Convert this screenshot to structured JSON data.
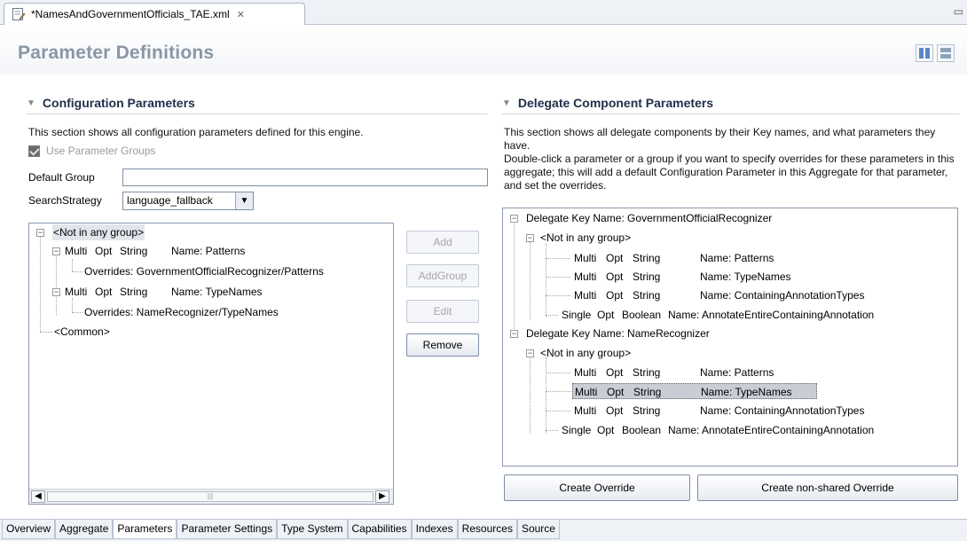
{
  "editor": {
    "filename": "*NamesAndGovernmentOfficials_TAE.xml"
  },
  "page": {
    "title": "Parameter Definitions"
  },
  "config": {
    "title": "Configuration Parameters",
    "description": "This section shows all configuration parameters defined for this engine.",
    "use_groups_label": "Use Parameter Groups",
    "use_groups_checked": true,
    "default_group_label": "Default Group",
    "default_group_value": "",
    "search_strategy_label": "SearchStrategy",
    "search_strategy_value": "language_fallback",
    "tree": {
      "group_not_in_any": "<Not in any group>",
      "params": [
        {
          "mult": "Multi",
          "opt": "Opt",
          "type": "String",
          "name": "Name: Patterns",
          "override": "Overrides: GovernmentOfficialRecognizer/Patterns"
        },
        {
          "mult": "Multi",
          "opt": "Opt",
          "type": "String",
          "name": "Name: TypeNames",
          "override": "Overrides: NameRecognizer/TypeNames"
        }
      ],
      "group_common": "<Common>"
    },
    "buttons": {
      "add": "Add",
      "add_group": "AddGroup",
      "edit": "Edit",
      "remove": "Remove"
    }
  },
  "delegate": {
    "title": "Delegate Component Parameters",
    "description_1": "This section shows all delegate components by their Key names, and what parameters they have.",
    "description_2": "Double-click a parameter or a group if you want to specify overrides for these parameters in this aggregate; this will add a default Configuration Parameter in this Aggregate for that parameter, and set the overrides.",
    "delegates": [
      {
        "key": "Delegate Key Name: GovernmentOfficialRecognizer",
        "group": "<Not in any group>",
        "params": [
          {
            "mult": "Multi",
            "opt": "Opt",
            "type": "String",
            "name": "Name: Patterns"
          },
          {
            "mult": "Multi",
            "opt": "Opt",
            "type": "String",
            "name": "Name: TypeNames"
          },
          {
            "mult": "Multi",
            "opt": "Opt",
            "type": "String",
            "name": "Name: ContainingAnnotationTypes"
          },
          {
            "mult": "Single",
            "opt": "Opt",
            "type": "Boolean",
            "name": "Name: AnnotateEntireContainingAnnotation"
          }
        ]
      },
      {
        "key": "Delegate Key Name: NameRecognizer",
        "group": "<Not in any group>",
        "params": [
          {
            "mult": "Multi",
            "opt": "Opt",
            "type": "String",
            "name": "Name: Patterns"
          },
          {
            "mult": "Multi",
            "opt": "Opt",
            "type": "String",
            "name": "Name: TypeNames"
          },
          {
            "mult": "Multi",
            "opt": "Opt",
            "type": "String",
            "name": "Name: ContainingAnnotationTypes"
          },
          {
            "mult": "Single",
            "opt": "Opt",
            "type": "Boolean",
            "name": "Name: AnnotateEntireContainingAnnotation"
          }
        ]
      }
    ],
    "buttons": {
      "create_override": "Create Override",
      "create_non_shared": "Create non-shared Override"
    }
  },
  "bottom_tabs": [
    "Overview",
    "Aggregate",
    "Parameters",
    "Parameter Settings",
    "Type System",
    "Capabilities",
    "Indexes",
    "Resources",
    "Source"
  ],
  "active_tab": "Parameters",
  "colors": {
    "title": "#8a96a6",
    "section": "#1f2f4a",
    "selection": "#c8cdd6"
  }
}
